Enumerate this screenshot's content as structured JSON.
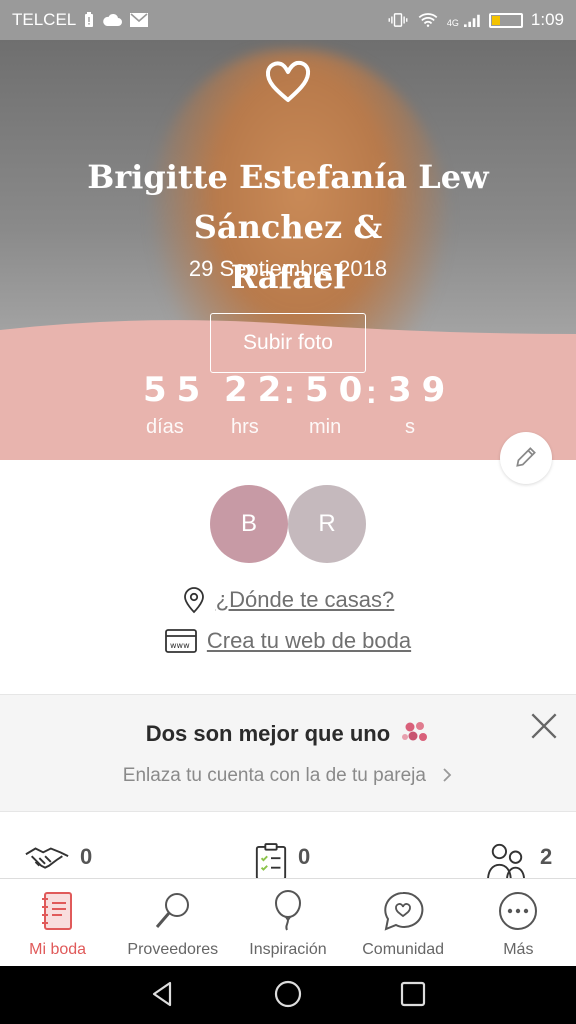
{
  "status_bar": {
    "carrier": "TELCEL",
    "network": "4G",
    "time": "1:09",
    "battery_percent": 25,
    "icons": [
      "battery-alert-icon",
      "cloud-icon",
      "mail-icon",
      "vibrate-icon",
      "wifi-icon",
      "signal-icon",
      "battery-icon"
    ]
  },
  "hero": {
    "couple_name_line1": "Brigitte Estefanía Lew Sánchez &",
    "couple_name_line2": "Rafael",
    "date": "29 Septiembre 2018",
    "upload_label": "Subir foto",
    "countdown": {
      "days": "55",
      "hours": "22",
      "minutes": "50",
      "seconds": "39",
      "days_label": "días",
      "hours_label": "hrs",
      "minutes_label": "min",
      "seconds_label": "s",
      "separator": ":"
    },
    "colors": {
      "pink_band": "#e8b4ae"
    }
  },
  "avatars": [
    {
      "initial": "B",
      "color": "#c79aa5"
    },
    {
      "initial": "R",
      "color": "#c5b9bd"
    }
  ],
  "links": {
    "location": "¿Dónde te casas?",
    "website": "Crea tu web de boda"
  },
  "promo": {
    "title": "Dos son mejor que uno",
    "subtitle": "Enlaza tu cuenta con la de tu pareja"
  },
  "stats": [
    {
      "icon": "handshake-icon",
      "value": "0"
    },
    {
      "icon": "checklist-icon",
      "value": "0"
    },
    {
      "icon": "guests-icon",
      "value": "2"
    }
  ],
  "bottom_nav": [
    {
      "label": "Mi boda",
      "icon": "notebook-icon",
      "active": true
    },
    {
      "label": "Proveedores",
      "icon": "search-icon",
      "active": false
    },
    {
      "label": "Inspiración",
      "icon": "balloon-icon",
      "active": false
    },
    {
      "label": "Comunidad",
      "icon": "chat-heart-icon",
      "active": false
    },
    {
      "label": "Más",
      "icon": "more-icon",
      "active": false
    }
  ],
  "colors": {
    "accent": "#e05a5a",
    "text_muted": "#707070"
  }
}
